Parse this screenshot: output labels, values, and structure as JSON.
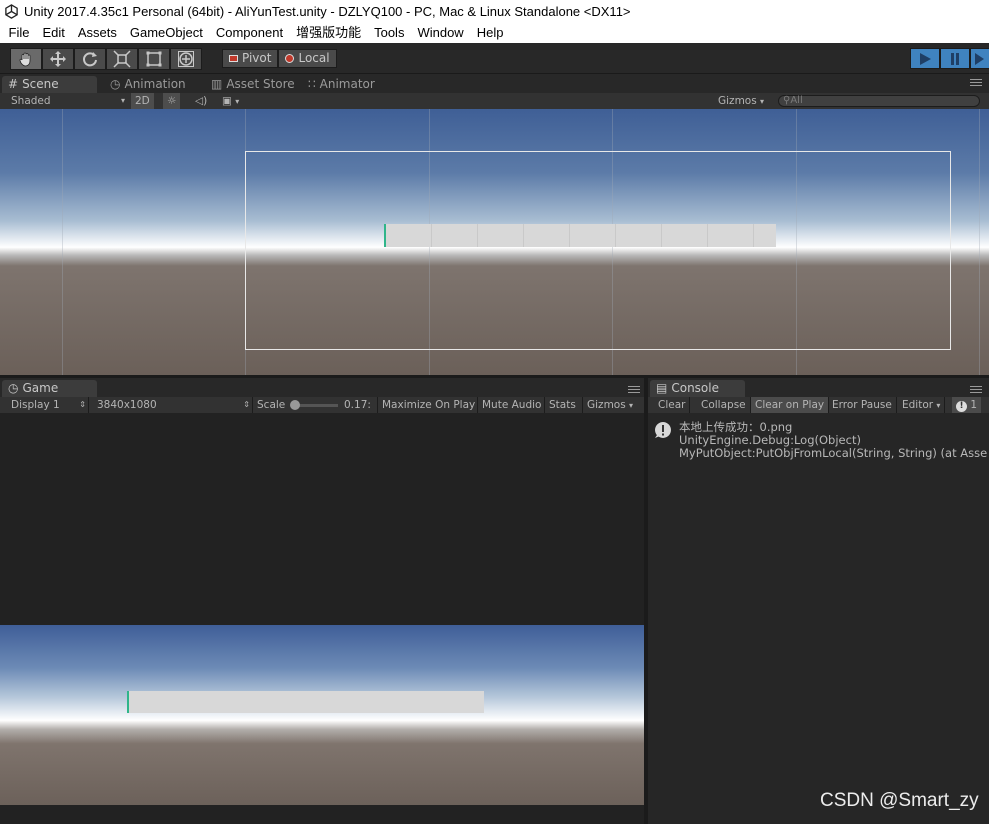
{
  "window": {
    "title": "Unity 2017.4.35c1 Personal (64bit) - AliYunTest.unity - DZLYQ100 - PC, Mac & Linux Standalone <DX11>"
  },
  "menu": [
    "File",
    "Edit",
    "Assets",
    "GameObject",
    "Component",
    "增强版功能",
    "Tools",
    "Window",
    "Help"
  ],
  "toolbar": {
    "tools": [
      "hand-tool",
      "move-tool",
      "rotate-tool",
      "scale-tool",
      "rect-tool",
      "transform-tool"
    ],
    "pivot_label": "Pivot",
    "local_label": "Local"
  },
  "tabs_top": {
    "scene": "Scene",
    "animation": "Animation",
    "asset_store": "Asset Store",
    "animator": "Animator"
  },
  "scene_bar": {
    "shading": "Shaded",
    "mode_2d": "2D",
    "gizmos": "Gizmos",
    "search_placeholder": "All"
  },
  "game": {
    "tab": "Game",
    "display": "Display 1",
    "resolution": "3840x1080",
    "scale_label": "Scale",
    "scale_value": "0.17:",
    "maximize": "Maximize On Play",
    "mute": "Mute Audio",
    "stats": "Stats",
    "gizmos": "Gizmos"
  },
  "console": {
    "tab": "Console",
    "buttons": [
      "Clear",
      "Collapse",
      "Clear on Play",
      "Error Pause",
      "Editor"
    ],
    "count": "1",
    "entry": {
      "line1": "本地上传成功：0.png",
      "line2": "UnityEngine.Debug:Log(Object)",
      "line3": "MyPutObject:PutObjFromLocal(String, String) (at Asse"
    }
  },
  "watermark": "CSDN @Smart_zy"
}
